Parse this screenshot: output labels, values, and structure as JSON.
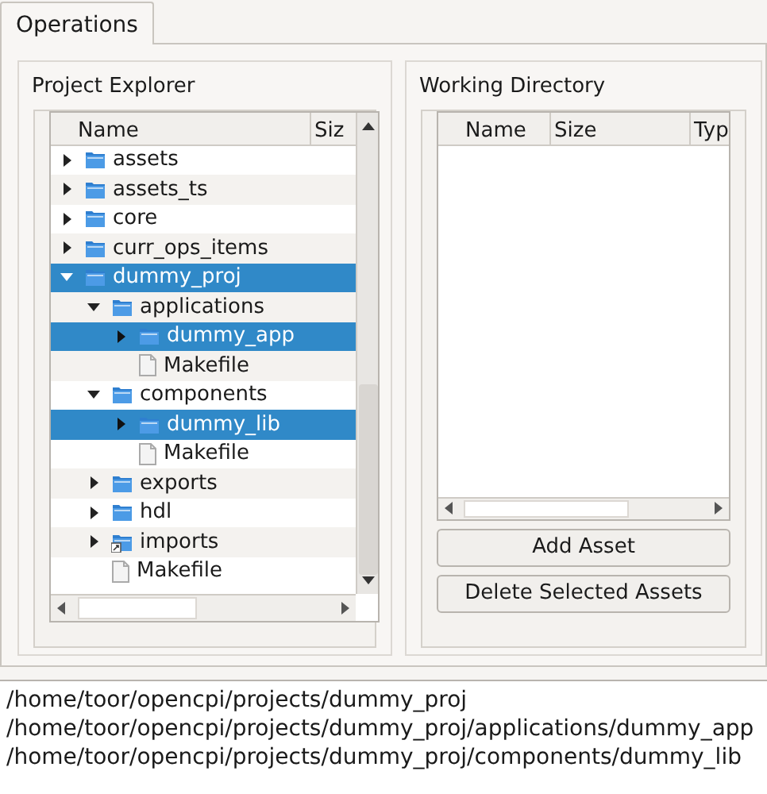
{
  "tabs": [
    {
      "label": "Operations",
      "selected": true
    }
  ],
  "project_explorer": {
    "title": "Project Explorer",
    "columns": [
      "Name",
      "Siz"
    ],
    "tree": [
      {
        "name": "assets",
        "kind": "folder",
        "expanded": false,
        "selected": false
      },
      {
        "name": "assets_ts",
        "kind": "folder",
        "expanded": false,
        "selected": false
      },
      {
        "name": "core",
        "kind": "folder",
        "expanded": false,
        "selected": false
      },
      {
        "name": "curr_ops_items",
        "kind": "folder",
        "expanded": false,
        "selected": false
      },
      {
        "name": "dummy_proj",
        "kind": "folder",
        "expanded": true,
        "selected": true,
        "children": [
          {
            "name": "applications",
            "kind": "folder",
            "expanded": true,
            "selected": false,
            "children": [
              {
                "name": "dummy_app",
                "kind": "folder",
                "expanded": false,
                "selected": true
              },
              {
                "name": "Makefile",
                "kind": "file",
                "selected": false
              }
            ]
          },
          {
            "name": "components",
            "kind": "folder",
            "expanded": true,
            "selected": false,
            "children": [
              {
                "name": "dummy_lib",
                "kind": "folder",
                "expanded": false,
                "selected": true
              },
              {
                "name": "Makefile",
                "kind": "file",
                "selected": false
              }
            ]
          },
          {
            "name": "exports",
            "kind": "folder",
            "expanded": false,
            "selected": false
          },
          {
            "name": "hdl",
            "kind": "folder",
            "expanded": false,
            "selected": false
          },
          {
            "name": "imports",
            "kind": "linked_folder",
            "expanded": false,
            "selected": false
          },
          {
            "name": "Makefile",
            "kind": "file",
            "selected": false
          }
        ]
      }
    ]
  },
  "working_directory": {
    "title": "Working Directory",
    "columns": [
      "Name",
      "Size",
      "Typ"
    ],
    "buttons": [
      "Add Asset",
      "Delete Selected Assets"
    ]
  },
  "output": [
    "/home/toor/opencpi/projects/dummy_proj",
    "/home/toor/opencpi/projects/dummy_proj/applications/dummy_app",
    "/home/toor/opencpi/projects/dummy_proj/components/dummy_lib"
  ]
}
